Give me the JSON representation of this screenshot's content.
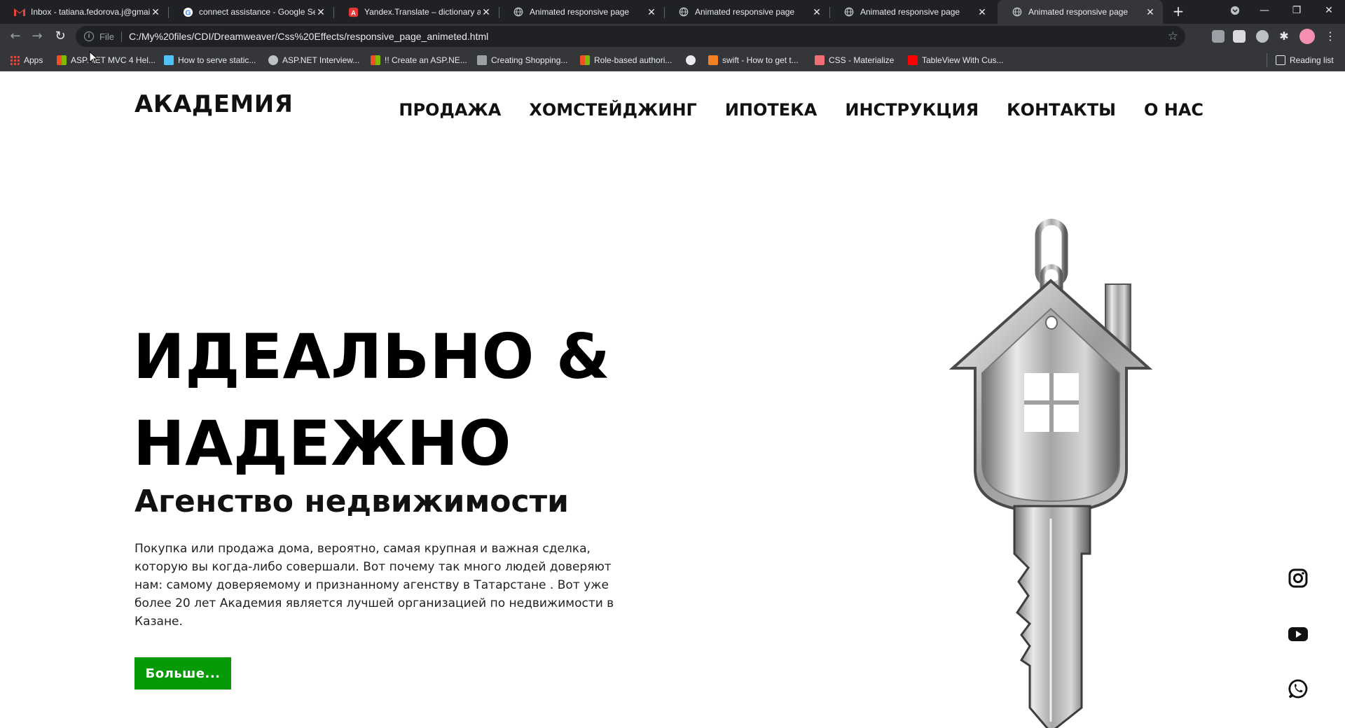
{
  "browser": {
    "tabs": [
      {
        "title": "Inbox - tatiana.fedorova.j@gmail.com",
        "icon": "gmail-icon"
      },
      {
        "title": "connect assistance - Google Search",
        "icon": "google-icon"
      },
      {
        "title": "Yandex.Translate – dictionary and online translation",
        "icon": "yandex-translate-icon"
      },
      {
        "title": "Animated responsive page",
        "icon": "globe-icon"
      },
      {
        "title": "Animated responsive page",
        "icon": "globe-icon"
      },
      {
        "title": "Animated responsive page",
        "icon": "globe-icon"
      },
      {
        "title": "Animated responsive page",
        "icon": "globe-icon"
      }
    ],
    "address": {
      "scheme": "File",
      "url": "C:/My%20files/CDI/Dreamweaver/Css%20Effects/responsive_page_animeted.html"
    },
    "bookmarks": [
      {
        "label": "Apps",
        "icon": "apps-grid-icon"
      },
      {
        "label": "ASP.NET MVC 4 Hel...",
        "icon": "microsoft-icon"
      },
      {
        "label": "How to serve static...",
        "icon": "feather-icon"
      },
      {
        "label": "ASP.NET Interview...",
        "icon": "gear-icon"
      },
      {
        "label": "!! Create an ASP.NE...",
        "icon": "microsoft-icon"
      },
      {
        "label": "Creating Shopping...",
        "icon": "cart-icon"
      },
      {
        "label": "Role-based authori...",
        "icon": "microsoft-icon"
      },
      {
        "label": "",
        "icon": "globe-icon"
      },
      {
        "label": "swift - How to get t...",
        "icon": "stackoverflow-icon"
      },
      {
        "label": "CSS - Materialize",
        "icon": "materialize-icon"
      },
      {
        "label": "TableView With Cus...",
        "icon": "youtube-icon"
      }
    ],
    "reading_list": "Reading list"
  },
  "site": {
    "logo": "АКАДЕМИЯ",
    "nav": [
      "ПРОДАЖА",
      "ХОМСТЕЙДЖИНГ",
      "ИПОТЕКА",
      "ИНСТРУКЦИЯ",
      "КОНТАКТЫ",
      "О НАС"
    ],
    "hero": {
      "title_line1": "ИДЕАЛЬНО &",
      "title_line2": "НАДЕЖНО",
      "subtitle": "Агенство недвижимости",
      "description": "Покупка или продажа дома, вероятно, самая крупная и важная сделка, которую вы когда-либо совершали. Вот почему так много людей доверяют нам: самому доверяемому и признанному агенству в Татарстане . Вот уже более 20 лет Академия является лучшей организацией по недвижимости в Казане.",
      "button": "Больше..."
    },
    "social": [
      "instagram-icon",
      "youtube-icon",
      "whatsapp-icon"
    ]
  },
  "colors": {
    "chrome_dark": "#202124",
    "chrome_toolbar": "#35363a",
    "button_green": "#079a07",
    "text": "#111111"
  }
}
